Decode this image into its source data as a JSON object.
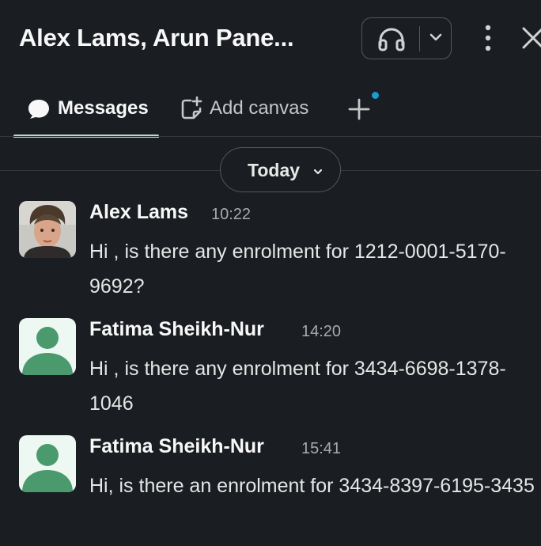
{
  "header": {
    "title": "Alex Lams, Arun Pane...",
    "icons": [
      "headphones-icon",
      "chevron-down-icon",
      "kebab-menu-icon",
      "close-icon"
    ]
  },
  "tabs": [
    {
      "label": "Messages",
      "icon": "message-bubble-icon",
      "active": true
    },
    {
      "label": "Add canvas",
      "icon": "canvas-icon",
      "active": false
    },
    {
      "label": "",
      "icon": "plus-icon",
      "badge": true
    }
  ],
  "date_divider": {
    "label": "Today"
  },
  "messages": [
    {
      "sender": "Alex Lams",
      "time": "10:22",
      "text": "Hi , is there any enrolment for 1212-0001-5170-9692?",
      "avatar": "photo"
    },
    {
      "sender": "Fatima Sheikh-Nur",
      "time": "14:20",
      "text": "Hi , is there any enrolment for 3434-6698-1378-1046",
      "avatar": "placeholder"
    },
    {
      "sender": "Fatima Sheikh-Nur",
      "time": "15:41",
      "text": "Hi, is there an enrolment for 3434-8397-6195-3435",
      "avatar": "placeholder"
    }
  ],
  "colors": {
    "background": "#1a1d21",
    "tab_underline": "#abe0d0",
    "badge": "#1d9bd1",
    "avatar_person": "#4a9a6e"
  }
}
